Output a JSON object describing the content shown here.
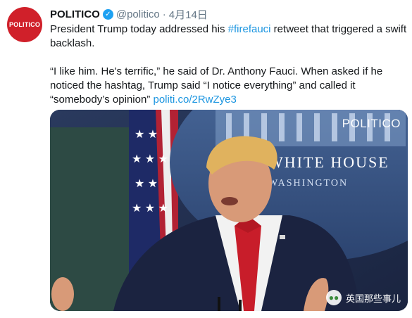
{
  "account": {
    "avatar_text": "POLITICO",
    "display_name": "POLITICO",
    "handle": "@politico",
    "separator": "·",
    "date": "4月14日",
    "verified_icon": "verified-badge-icon"
  },
  "tweet": {
    "line1_pre": "President Trump today addressed his ",
    "hashtag": "#firefauci",
    "line1_post": " retweet that triggered a swift backlash.",
    "para2": "“I like him. He's terrific,” he said of Dr. Anthony Fauci. When asked if he noticed the hashtag, Trump said “I notice everything” and called it “somebody’s opinion” ",
    "link": "politi.co/2RwZye3"
  },
  "media": {
    "brand_watermark": "POLITICO",
    "backdrop_line1": "WHITE HOUSE",
    "backdrop_line2": "WASHINGTON",
    "wechat_watermark": "英国那些事儿",
    "wechat_icon": "wechat-icon"
  },
  "colors": {
    "brand_red": "#d0202a",
    "link_blue": "#1b95e0",
    "verified_blue": "#1da1f2"
  }
}
